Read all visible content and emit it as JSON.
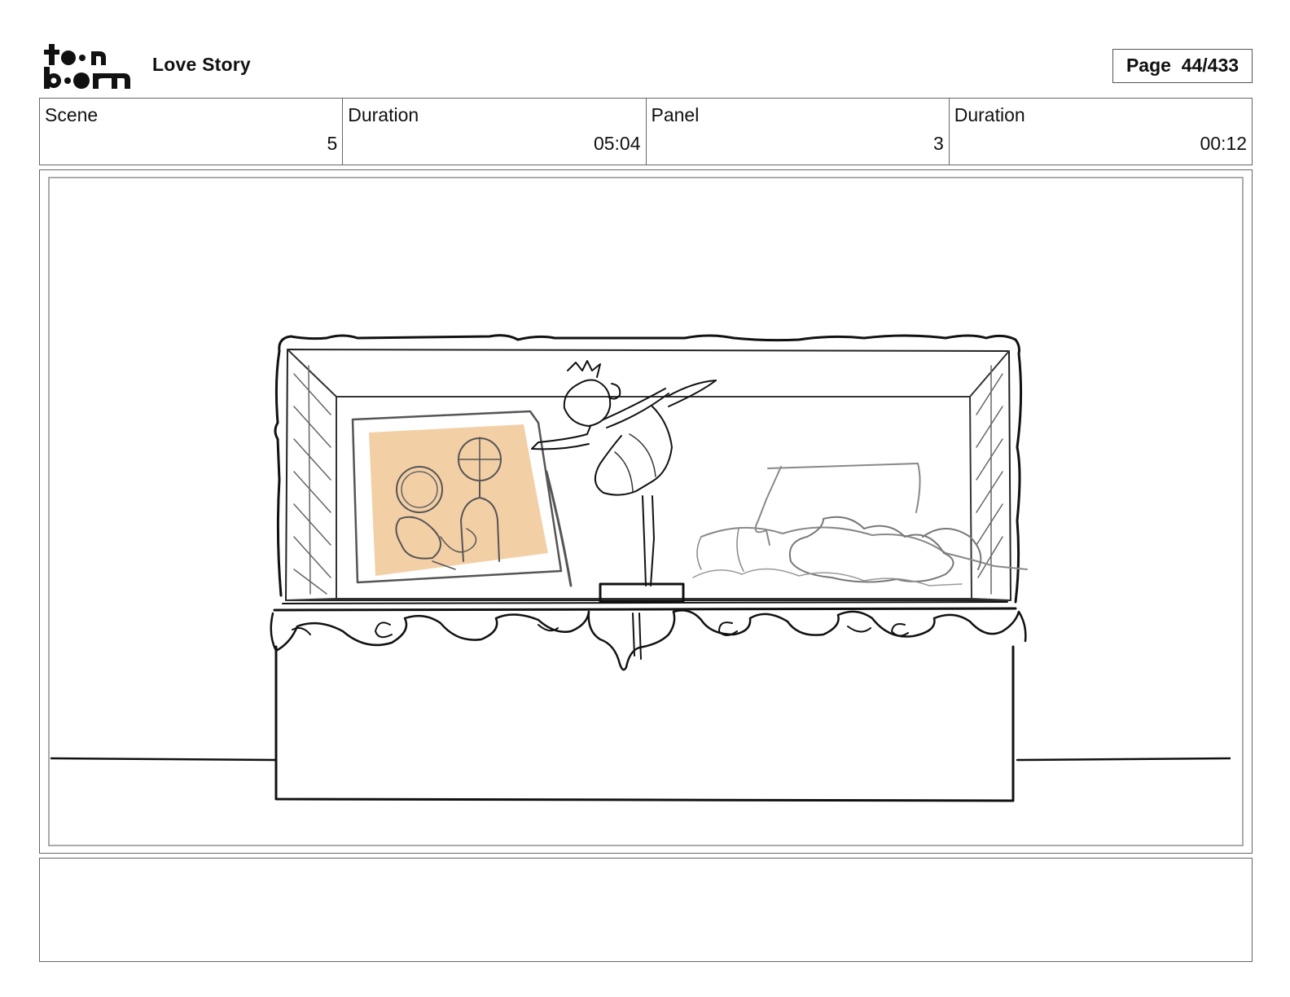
{
  "header": {
    "logo_text": "toonboom",
    "project_title": "Love Story",
    "page_label": "Page",
    "page_number": "44/433"
  },
  "info": [
    {
      "label": "Scene",
      "value": "5"
    },
    {
      "label": "Duration",
      "value": "05:04"
    },
    {
      "label": "Panel",
      "value": "3"
    },
    {
      "label": "Duration",
      "value": "00:12"
    }
  ],
  "panel": {
    "sketch_icon": "music-box-ballerina-sketch",
    "accent_color": "#f3cfa6"
  },
  "notes": {
    "text": ""
  }
}
